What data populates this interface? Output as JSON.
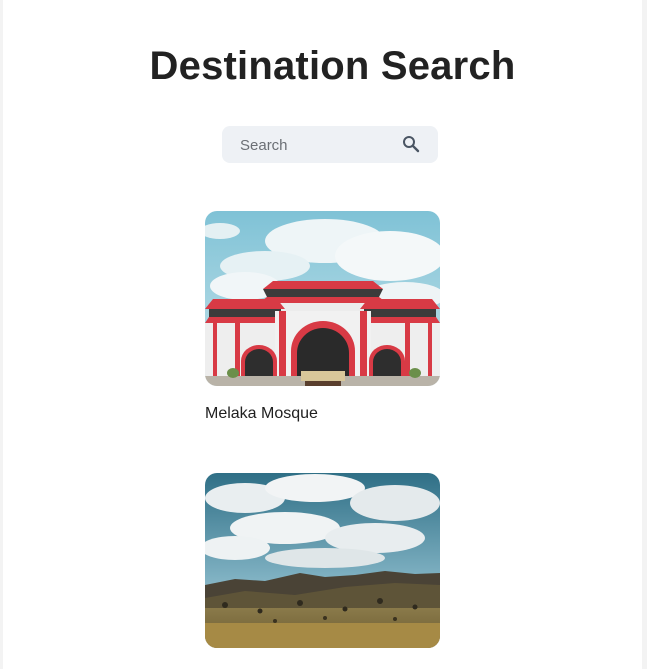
{
  "page": {
    "title": "Destination Search"
  },
  "search": {
    "placeholder": "Search",
    "icon": "search-icon"
  },
  "destinations": [
    {
      "name": "Melaka Mosque",
      "image": "mosque-photo"
    },
    {
      "name": "",
      "image": "grassland-landscape-photo"
    }
  ],
  "colors": {
    "search_bg": "#eef1f5",
    "mosque_red": "#d83a45",
    "sky_blue": "#9fd0df"
  }
}
